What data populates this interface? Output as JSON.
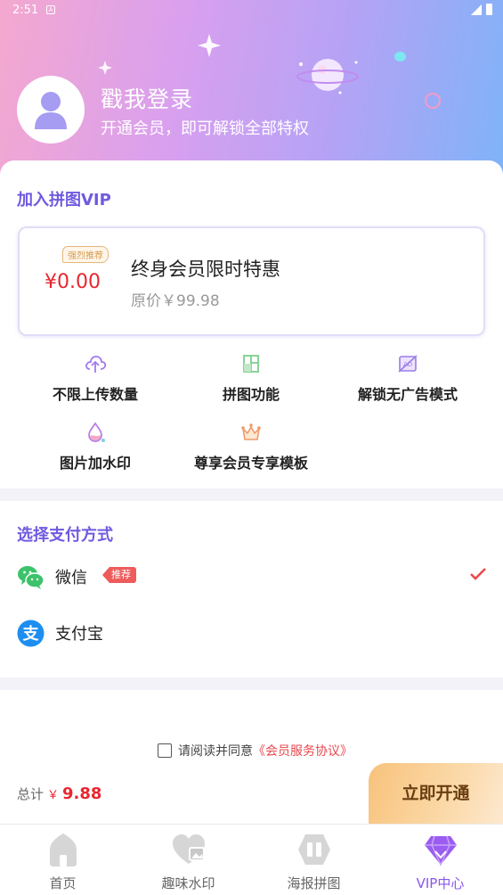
{
  "status_bar": {
    "time": "2:51",
    "notification_icon": "A"
  },
  "header": {
    "login_title": "戳我登录",
    "login_subtitle": "开通会员，即可解锁全部特权"
  },
  "vip_section": {
    "title": "加入拼图VIP",
    "offer": {
      "badge": "强烈推荐",
      "price": "¥0.00",
      "title": "终身会员限时特惠",
      "original_price": "原价￥99.98"
    },
    "features": [
      {
        "label": "不限上传数量",
        "icon": "cloud-upload-icon"
      },
      {
        "label": "拼图功能",
        "icon": "collage-icon"
      },
      {
        "label": "解锁无广告模式",
        "icon": "no-ads-icon"
      },
      {
        "label": "图片加水印",
        "icon": "watermark-drop-icon"
      },
      {
        "label": "尊享会员专享模板",
        "icon": "crown-icon"
      }
    ]
  },
  "payment_section": {
    "title": "选择支付方式",
    "methods": [
      {
        "label": "微信",
        "tag": "推荐",
        "selected": true,
        "icon": "wechat-icon"
      },
      {
        "label": "支付宝",
        "selected": false,
        "icon": "alipay-icon"
      }
    ]
  },
  "agreement": {
    "prefix": "请阅读并同意",
    "link": "《会员服务协议》",
    "checked": false
  },
  "footer": {
    "total_label": "总计",
    "currency": "￥",
    "total_amount": "9.88",
    "open_button": "立即开通"
  },
  "tabbar": {
    "tabs": [
      {
        "label": "首页",
        "icon": "home-icon",
        "active": false
      },
      {
        "label": "趣味水印",
        "icon": "heart-image-icon",
        "active": false
      },
      {
        "label": "海报拼图",
        "icon": "poster-icon",
        "active": false
      },
      {
        "label": "VIP中心",
        "icon": "diamond-icon",
        "active": true
      }
    ]
  },
  "colors": {
    "accent_purple": "#6f5ae0",
    "price_red": "#e8262f",
    "button_gold": "#f8c27c"
  }
}
